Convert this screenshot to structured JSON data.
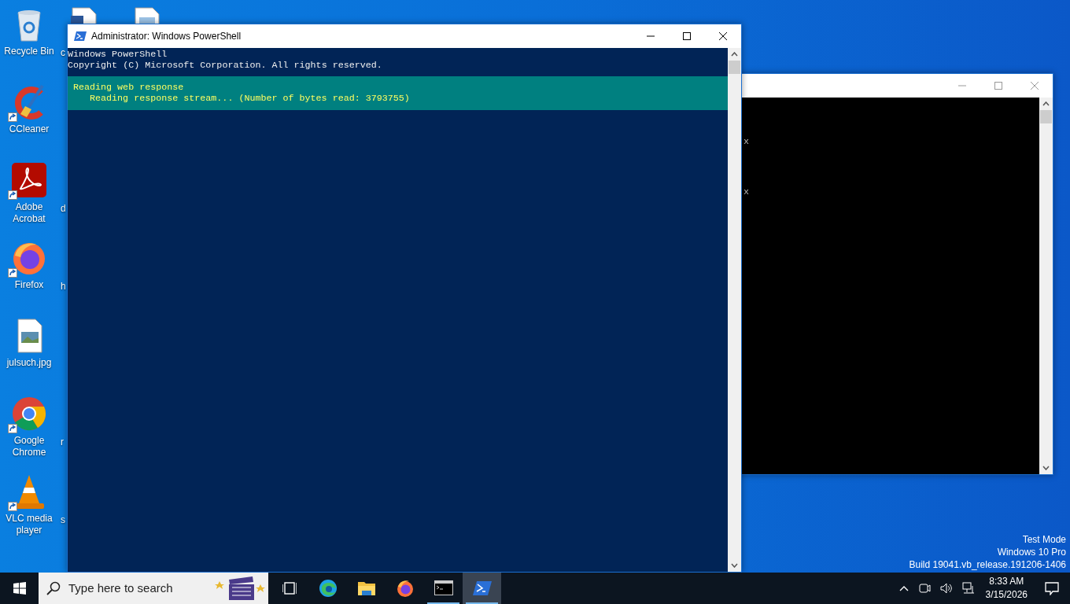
{
  "desktop_icons": [
    {
      "label": "Recycle Bin",
      "kind": "recycle",
      "shortcut": false
    },
    {
      "label": "CCleaner",
      "kind": "ccleaner",
      "shortcut": true
    },
    {
      "label": "Adobe Acrobat",
      "kind": "acrobat",
      "shortcut": true
    },
    {
      "label": "Firefox",
      "kind": "firefox",
      "shortcut": true
    },
    {
      "label": "julsuch.jpg",
      "kind": "image",
      "shortcut": false
    },
    {
      "label": "Google Chrome",
      "kind": "chrome",
      "shortcut": true
    },
    {
      "label": "VLC media player",
      "kind": "vlc",
      "shortcut": true
    }
  ],
  "desktop_icons_column_2": [
    {
      "label": "c"
    },
    {
      "label": "d"
    },
    {
      "label": "h"
    },
    {
      "label": "r"
    },
    {
      "label": "s"
    }
  ],
  "top_icons": [
    {
      "kind": "word"
    },
    {
      "kind": "document"
    }
  ],
  "powershell_window": {
    "title": "Administrator: Windows PowerShell",
    "active": true,
    "lines": [
      "Windows PowerShell",
      "Copyright (C) Microsoft Corporation. All rights reserved."
    ],
    "progress": {
      "activity": "Reading web response",
      "status": "Reading response stream... (Number of bytes read: 3793755)"
    }
  },
  "console_window": {
    "active": false,
    "lines": [
      "x",
      "x"
    ]
  },
  "taskbar": {
    "search": {
      "placeholder": "Type here to search"
    },
    "apps": [
      {
        "kind": "taskview",
        "running": false,
        "selected": false
      },
      {
        "kind": "edge",
        "running": false,
        "selected": false
      },
      {
        "kind": "explorer",
        "running": false,
        "selected": false
      },
      {
        "kind": "firefox",
        "running": false,
        "selected": false
      },
      {
        "kind": "cmd",
        "running": true,
        "selected": false
      },
      {
        "kind": "powershell",
        "running": true,
        "selected": true
      }
    ],
    "time": "8:33 AM",
    "date": "3/15/2026"
  },
  "desktop_watermark": [
    "Test Mode",
    "Windows 10 Pro",
    "Build 19041.vb_release.191206-1406"
  ]
}
